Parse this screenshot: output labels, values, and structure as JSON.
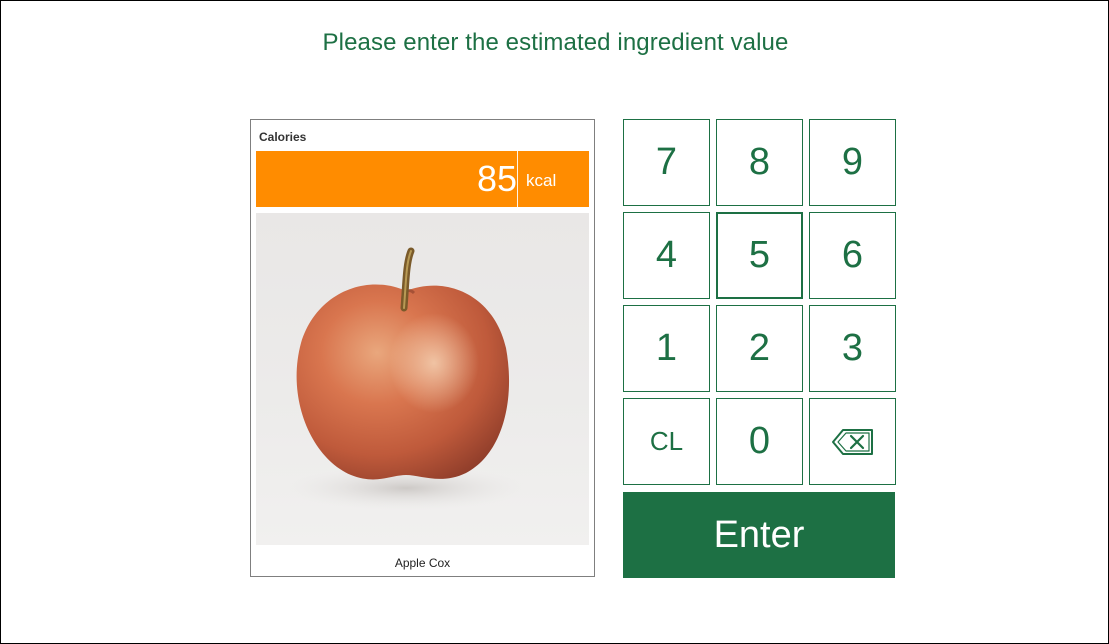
{
  "prompt": "Please enter the estimated ingredient value",
  "item": {
    "nutrient_label": "Calories",
    "value": "85",
    "unit": "kcal",
    "name": "Apple Cox",
    "accent_color": "#ff8c00"
  },
  "keypad": {
    "keys": [
      "7",
      "8",
      "9",
      "4",
      "5",
      "6",
      "1",
      "2",
      "3",
      "CL",
      "0"
    ],
    "backspace_icon": "backspace-icon",
    "enter_label": "Enter",
    "accent_color": "#1d7044"
  }
}
